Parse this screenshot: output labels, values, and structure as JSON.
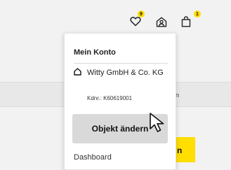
{
  "header": {
    "wishlist_badge": "9",
    "cart_badge": "1",
    "icons": [
      "heart-icon",
      "account-icon",
      "cart-icon"
    ],
    "badge_color": "#ffdd00"
  },
  "background": {
    "band_text": "ann",
    "button_text": "n",
    "accent_color": "#ffde00"
  },
  "account_menu": {
    "title": "Mein Konto",
    "company_name": "Witty GmbH & Co. KG",
    "customer_number": "Kdnr.: K60619001",
    "change_object_label": "Objekt ändern",
    "dashboard_label": "Dashboard"
  }
}
